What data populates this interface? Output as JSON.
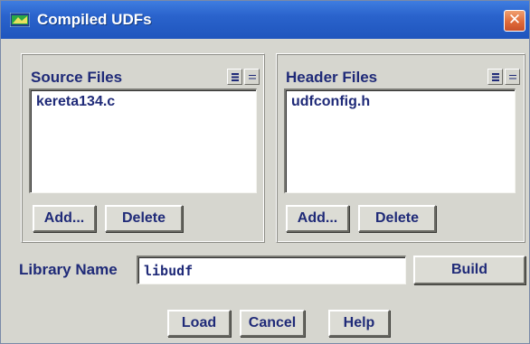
{
  "window": {
    "title": "Compiled UDFs",
    "close_glyph": "✕"
  },
  "source_files": {
    "title": "Source Files",
    "items": [
      "kereta134.c"
    ],
    "add_label": "Add...",
    "delete_label": "Delete"
  },
  "header_files": {
    "title": "Header Files",
    "items": [
      "udfconfig.h"
    ],
    "add_label": "Add...",
    "delete_label": "Delete"
  },
  "library": {
    "label": "Library Name",
    "value": "libudf",
    "build_label": "Build"
  },
  "footer": {
    "load_label": "Load",
    "cancel_label": "Cancel",
    "help_label": "Help"
  },
  "icons": {
    "app": "fluent-app-icon",
    "close": "close-icon",
    "select_all": "select-all-icon",
    "deselect_all": "deselect-all-icon"
  },
  "colors": {
    "titlebar": "#2a63cc",
    "close_button": "#e06b3a",
    "dialog_background": "#d6d6cf",
    "label_text": "#1f2a78"
  }
}
